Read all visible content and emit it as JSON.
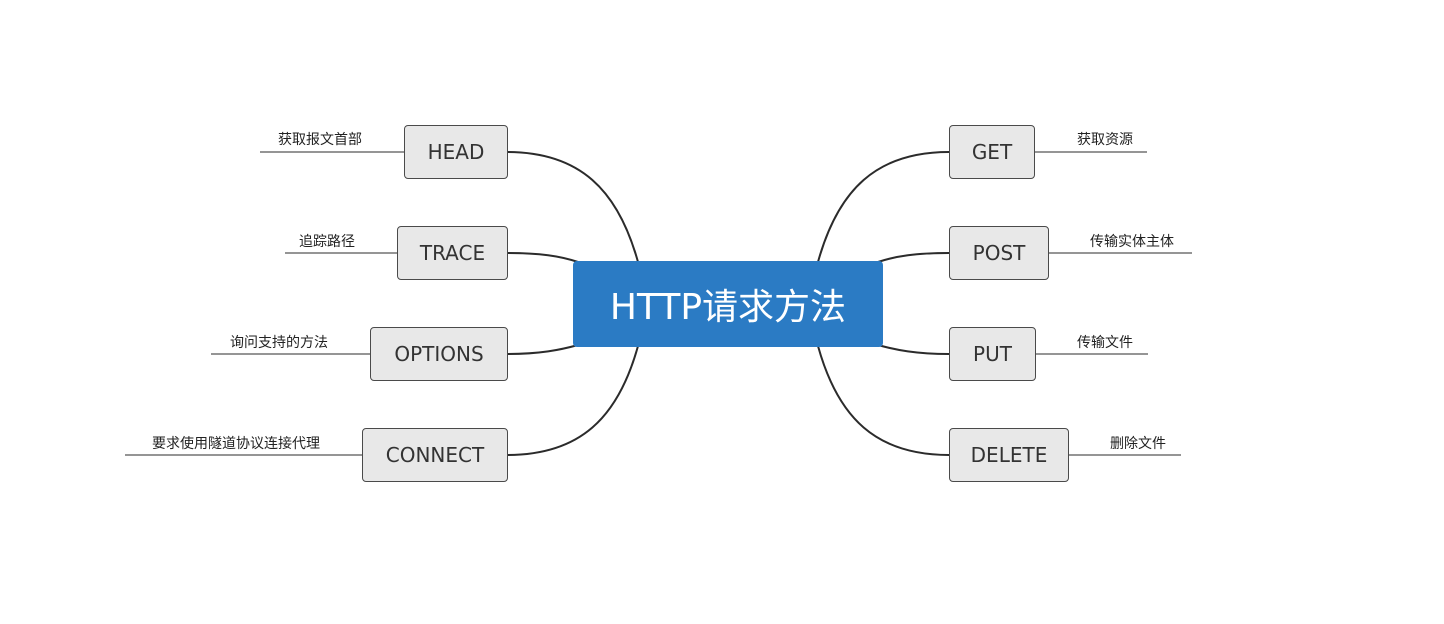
{
  "central": {
    "label": "HTTP请求方法"
  },
  "left_methods": [
    {
      "name": "HEAD",
      "description": "获取报文首部"
    },
    {
      "name": "TRACE",
      "description": "追踪路径"
    },
    {
      "name": "OPTIONS",
      "description": "询问支持的方法"
    },
    {
      "name": "CONNECT",
      "description": "要求使用隧道协议连接代理"
    }
  ],
  "right_methods": [
    {
      "name": "GET",
      "description": "获取资源"
    },
    {
      "name": "POST",
      "description": "传输实体主体"
    },
    {
      "name": "PUT",
      "description": "传输文件"
    },
    {
      "name": "DELETE",
      "description": "删除文件"
    }
  ],
  "colors": {
    "central_fill": "#2b7bc4",
    "node_fill": "#e8e8e8",
    "line": "#2b2b2b"
  }
}
